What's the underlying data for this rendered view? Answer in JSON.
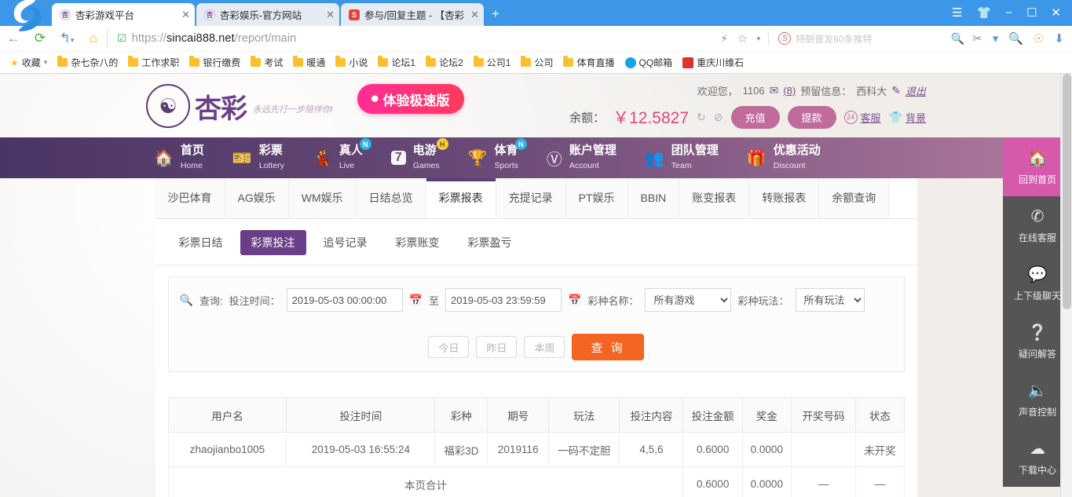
{
  "browser": {
    "tabs": [
      {
        "title": "杏彩游戏平台",
        "icon": "xingcai-favicon",
        "active": true,
        "close": "✕"
      },
      {
        "title": "杏彩娱乐-官方网站",
        "icon": "xingcai-favicon",
        "active": false,
        "close": "✕"
      },
      {
        "title": "参与/回复主题 - 【杏彩",
        "icon": "forum-favicon",
        "active": false,
        "close": "✕"
      }
    ],
    "new_tab_label": "+",
    "window_buttons": [
      "menu-icon",
      "skin-icon",
      "minimize-icon",
      "maximize-icon",
      "close-icon"
    ],
    "nav": {
      "back": "←",
      "reload": "⟳",
      "forward_history": "↰",
      "home": "⌂"
    },
    "url_prefix": "https://",
    "url_domain": "sincai888.net",
    "url_path": "/report/main",
    "search_placeholder": "特朗普发80条推特",
    "bookmarks": [
      {
        "label": "收藏",
        "icon": "star-icon"
      },
      {
        "label": "杂七杂八的",
        "icon": "folder-icon"
      },
      {
        "label": "工作求职",
        "icon": "folder-icon"
      },
      {
        "label": "银行缴费",
        "icon": "folder-icon"
      },
      {
        "label": "考试",
        "icon": "folder-icon"
      },
      {
        "label": "暖通",
        "icon": "folder-icon"
      },
      {
        "label": "小说",
        "icon": "folder-icon"
      },
      {
        "label": "论坛1",
        "icon": "folder-icon"
      },
      {
        "label": "论坛2",
        "icon": "folder-icon"
      },
      {
        "label": "公司1",
        "icon": "folder-icon"
      },
      {
        "label": "公司",
        "icon": "folder-icon"
      },
      {
        "label": "体育直播",
        "icon": "folder-icon"
      },
      {
        "label": "QQ邮箱",
        "icon": "qqmail-icon"
      },
      {
        "label": "重庆川维石",
        "icon": "site-icon"
      }
    ]
  },
  "site": {
    "logo_text": "杏彩",
    "logo_slogan": "永远先行一步陪伴你!",
    "speed_badge": "体验极速版",
    "welcome": {
      "greeting": "欢迎您，",
      "username": "1106",
      "mail_count": "(8)",
      "reserved_label": "预留信息：",
      "reserved_value": "西科大",
      "logout": "退出"
    },
    "balance": {
      "label": "余额：",
      "amount": "￥12.5827",
      "refresh_icon": "refresh-icon",
      "hide_icon": "eye-off-icon",
      "deposit": "充值",
      "withdraw": "提款",
      "service_badge": "24",
      "service": "客服",
      "skin": "背景"
    },
    "mainnav": [
      {
        "cn": "首页",
        "en": "Home",
        "icon": "home-icon",
        "badge": "",
        "badge_color": ""
      },
      {
        "cn": "彩票",
        "en": "Lottery",
        "icon": "ticket-icon",
        "badge": "",
        "badge_color": ""
      },
      {
        "cn": "真人",
        "en": "Live",
        "icon": "live-dealer-icon",
        "badge": "N",
        "badge_color": "#29b6e8"
      },
      {
        "cn": "电游",
        "en": "Games",
        "icon": "slot-seven-icon",
        "badge": "H",
        "badge_color": "#f4d03f"
      },
      {
        "cn": "体育",
        "en": "Sports",
        "icon": "trophy-icon",
        "badge": "N",
        "badge_color": "#29b6e8"
      },
      {
        "cn": "账户管理",
        "en": "Account",
        "icon": "yen-coin-icon",
        "badge": "",
        "badge_color": ""
      },
      {
        "cn": "团队管理",
        "en": "Team",
        "icon": "team-icon",
        "badge": "",
        "badge_color": ""
      },
      {
        "cn": "优惠活动",
        "en": "Discount",
        "icon": "gift-icon",
        "badge": "",
        "badge_color": ""
      }
    ],
    "tabs": [
      {
        "label": "沙巴体育",
        "active": false
      },
      {
        "label": "AG娱乐",
        "active": false
      },
      {
        "label": "WM娱乐",
        "active": false
      },
      {
        "label": "日结总览",
        "active": false
      },
      {
        "label": "彩票报表",
        "active": true
      },
      {
        "label": "充提记录",
        "active": false
      },
      {
        "label": "PT娱乐",
        "active": false
      },
      {
        "label": "BBIN",
        "active": false
      },
      {
        "label": "账变报表",
        "active": false
      },
      {
        "label": "转账报表",
        "active": false
      },
      {
        "label": "余额查询",
        "active": false
      }
    ],
    "subtabs": [
      {
        "label": "彩票日结",
        "active": false
      },
      {
        "label": "彩票投注",
        "active": true
      },
      {
        "label": "追号记录",
        "active": false
      },
      {
        "label": "彩票账变",
        "active": false
      },
      {
        "label": "彩票盈亏",
        "active": false
      }
    ],
    "filter": {
      "query_label": "查询:",
      "time_label": "投注时间：",
      "date_from": "2019-05-03 00:00:00",
      "between": "至",
      "date_to": "2019-05-03 23:59:59",
      "game_label": "彩种名称：",
      "game_value": "所有游戏",
      "play_label": "彩种玩法：",
      "play_value": "所有玩法",
      "buttons": {
        "today": "今日",
        "yesterday": "昨日",
        "week": "本周",
        "query": "查 询"
      }
    },
    "table": {
      "headers": [
        "用户名",
        "投注时间",
        "彩种",
        "期号",
        "玩法",
        "投注内容",
        "投注金额",
        "奖金",
        "开奖号码",
        "状态"
      ],
      "rows": [
        {
          "用户名": "zhaojianbo1005",
          "投注时间": "2019-05-03 16:55:24",
          "彩种": "福彩3D",
          "期号": "2019116",
          "玩法": "一码不定胆",
          "投注内容": "4,5,6",
          "投注金额": "0.6000",
          "奖金": "0.0000",
          "开奖号码": "",
          "状态": "未开奖"
        }
      ],
      "total": {
        "label": "本页合计",
        "投注金额": "0.6000",
        "奖金": "0.0000",
        "开奖号码": "—",
        "状态": "—"
      }
    },
    "floatbar": [
      {
        "label": "回到首页",
        "icon": "home-icon",
        "active": true
      },
      {
        "label": "在线客服",
        "icon": "headset-24-icon",
        "active": false
      },
      {
        "label": "上下级聊天",
        "icon": "chat-bubble-icon",
        "active": false
      },
      {
        "label": "疑问解答",
        "icon": "question-circle-icon",
        "active": false
      },
      {
        "label": "声音控制",
        "icon": "speaker-icon",
        "active": false
      },
      {
        "label": "下载中心",
        "icon": "cloud-download-icon",
        "active": false
      }
    ]
  },
  "colors": {
    "brand_purple": "#6b3f87",
    "nav_dark": "#4a3566",
    "accent_pink": "#d659ac",
    "query_orange": "#f26522",
    "status_green": "#4b9e4b",
    "balance_pink": "#d94a7c"
  }
}
